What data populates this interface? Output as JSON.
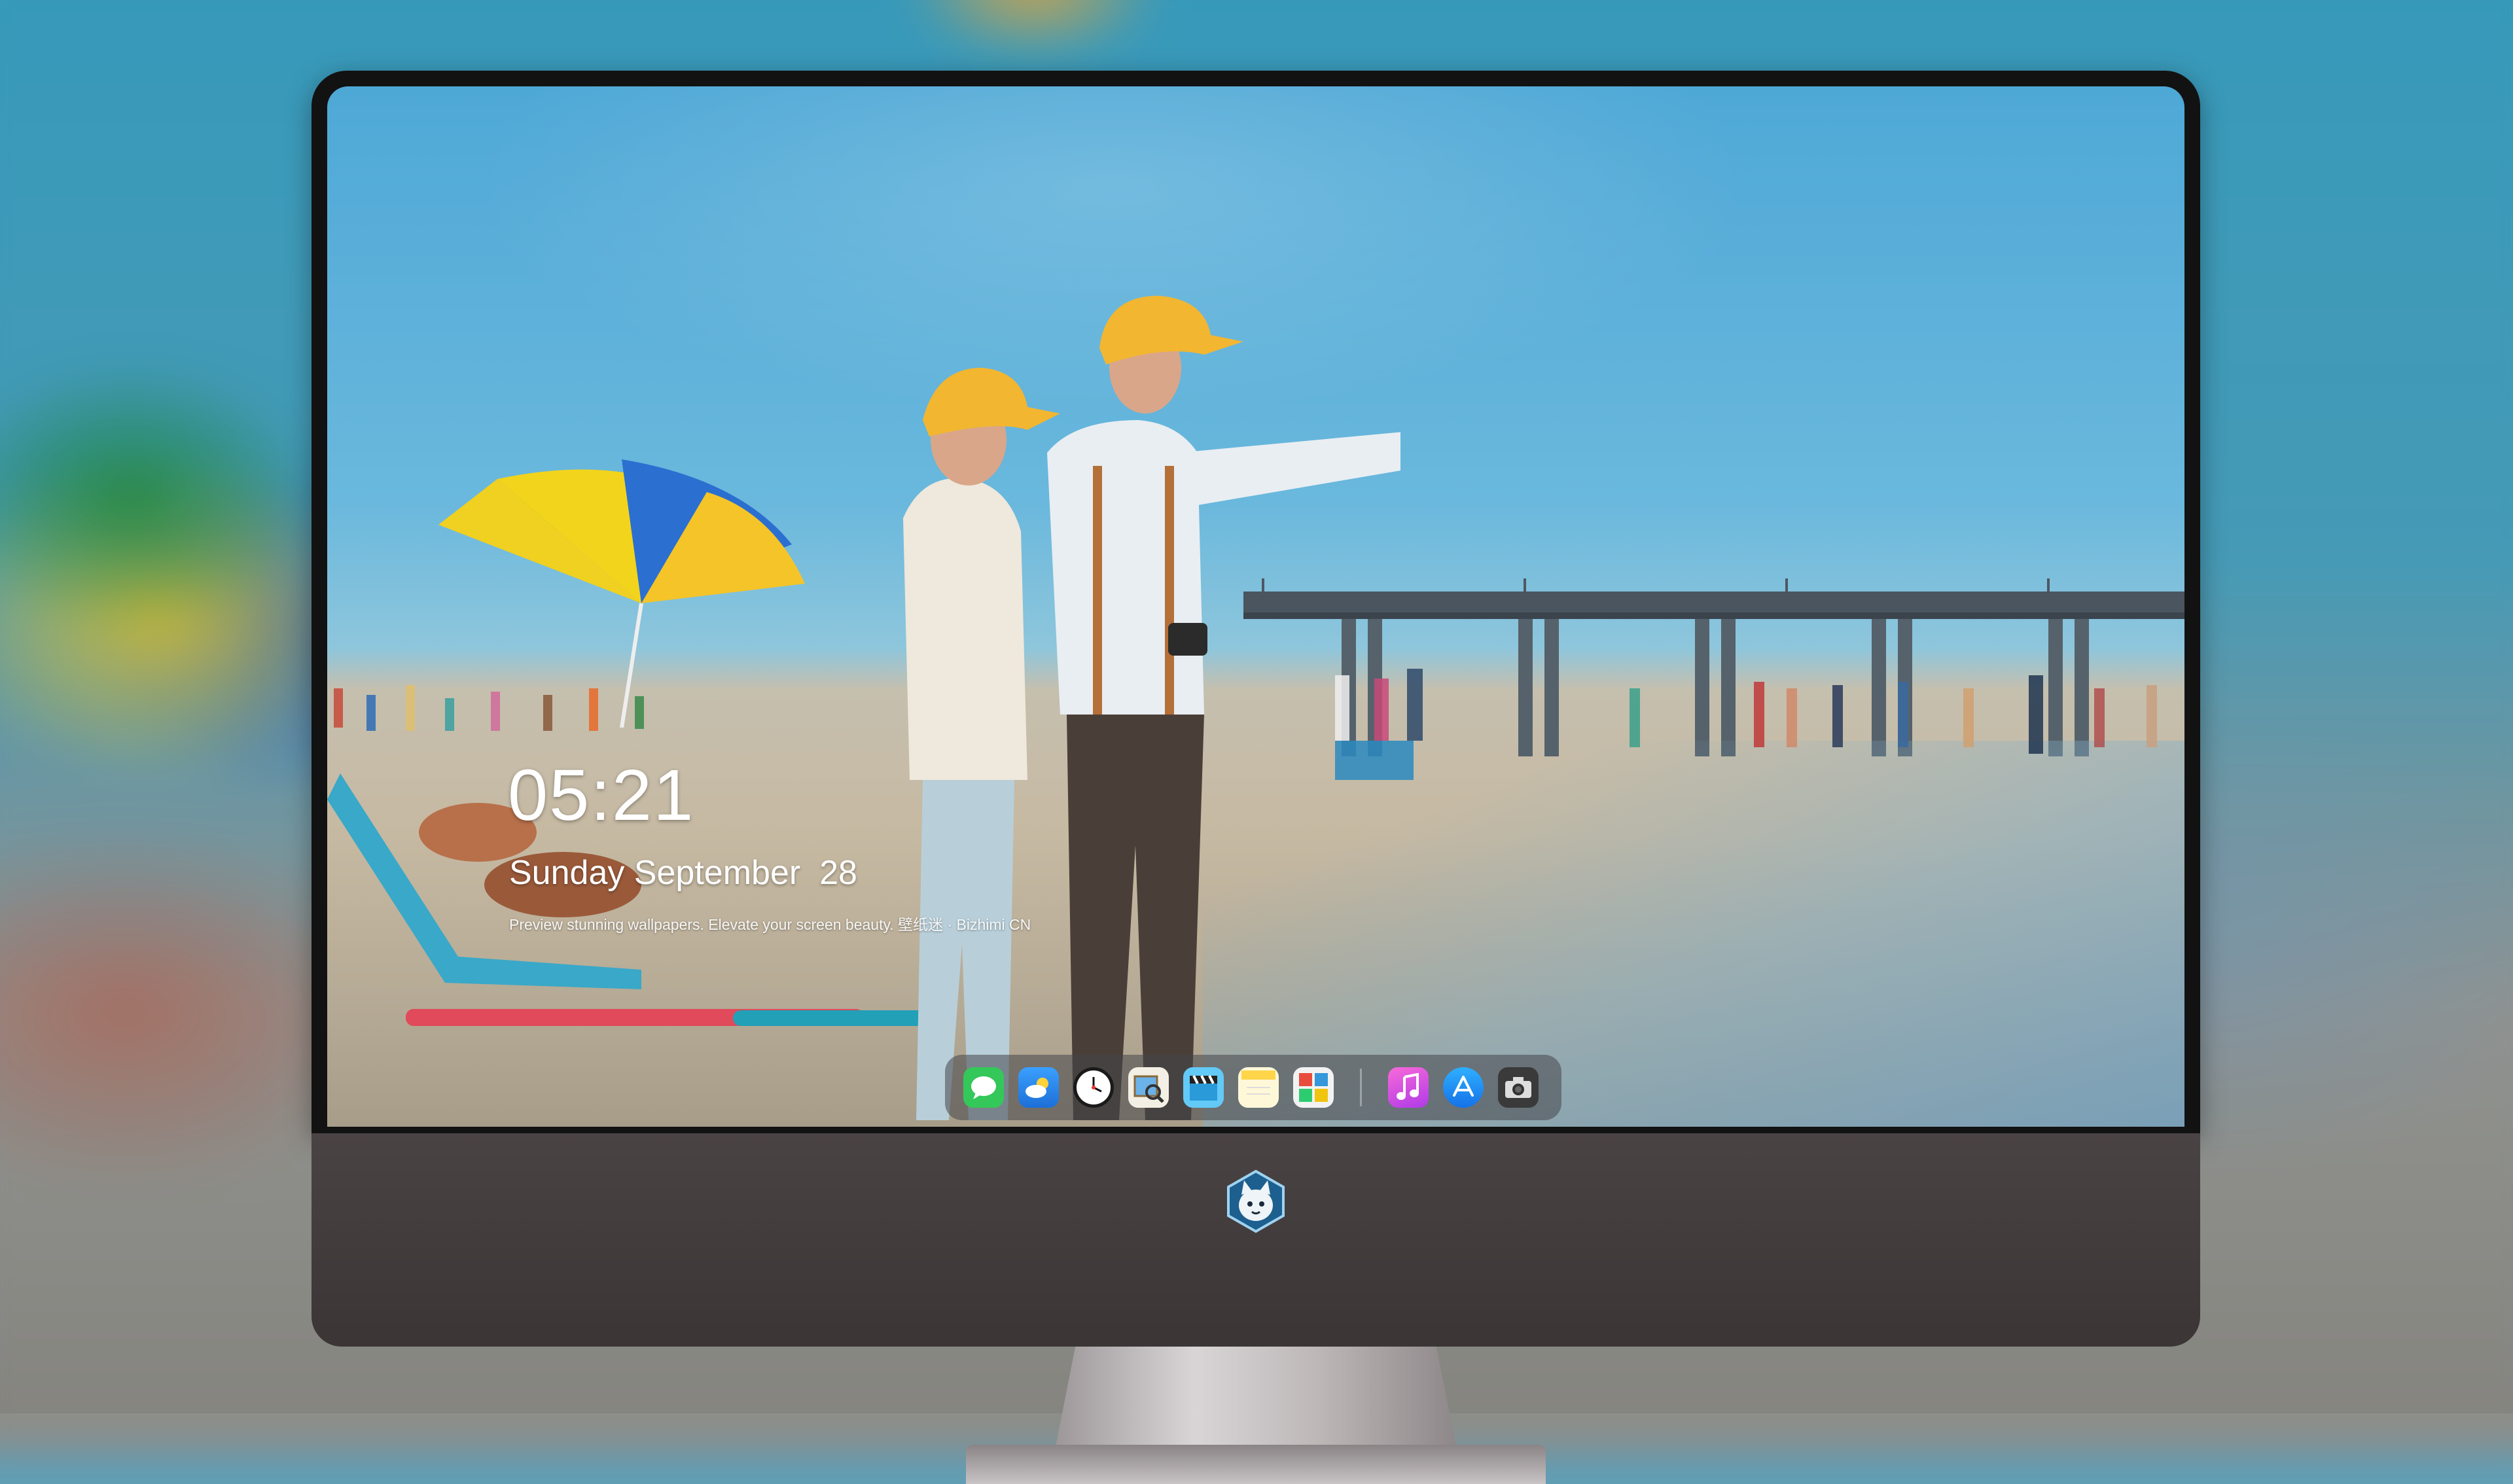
{
  "lock_screen": {
    "time": "05:21",
    "date": "Sunday September  28",
    "tagline": "Preview stunning wallpapers. Elevate your screen beauty. 壁纸迷 · Bizhimi CN"
  },
  "dock": {
    "apps": [
      {
        "name": "Messages",
        "icon": "messages-icon",
        "color": "#34c759"
      },
      {
        "name": "Weather",
        "icon": "weather-icon",
        "color": "#2f8df0"
      },
      {
        "name": "Clock",
        "icon": "clock-icon",
        "color": "#ffffff"
      },
      {
        "name": "Preview",
        "icon": "preview-icon",
        "color": "#e9e4d8"
      },
      {
        "name": "Clips",
        "icon": "clapperboard-icon",
        "color": "#5ac8fa"
      },
      {
        "name": "Notes",
        "icon": "notes-icon",
        "color": "#ffd54a"
      },
      {
        "name": "Photo Booth",
        "icon": "photo-booth-icon",
        "color": "#f2f2f2"
      },
      {
        "name": "iTunes",
        "icon": "music-icon",
        "color": "#e84cd8"
      },
      {
        "name": "App Store",
        "icon": "app-store-icon",
        "color": "#1c8ef9"
      },
      {
        "name": "Camera",
        "icon": "camera-icon",
        "color": "#4a4a4a"
      }
    ]
  },
  "monitor": {
    "logo_icon": "cat-mascot-logo-icon"
  }
}
